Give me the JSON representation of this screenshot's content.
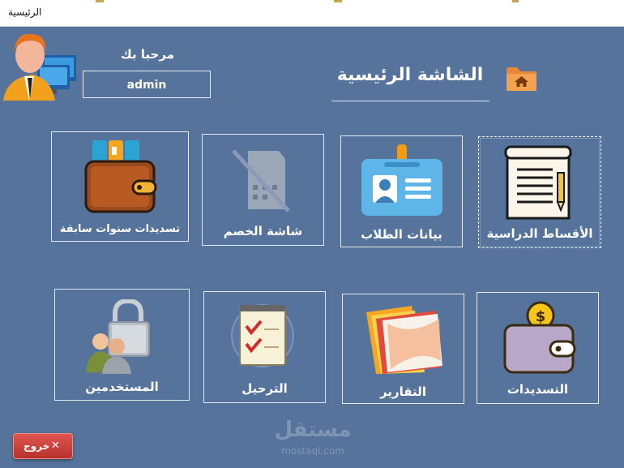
{
  "window": {
    "title": "الرئيسية"
  },
  "header": {
    "welcome": "مرحبا بك",
    "username": "admin",
    "page_title": "الشاشة الرئيسية"
  },
  "tiles_row1": [
    {
      "label": "الأقساط الدراسية",
      "icon": "notepad-icon"
    },
    {
      "label": "بيانات الطلاب",
      "icon": "id-badge-icon"
    },
    {
      "label": "شاشة الخصم",
      "icon": "discount-crossed-icon"
    },
    {
      "label": "تسديدات سنوات سابقة",
      "icon": "wallet-cards-icon"
    }
  ],
  "tiles_row2": [
    {
      "label": "التسديدات",
      "icon": "wallet-coin-icon"
    },
    {
      "label": "التقارير",
      "icon": "folder-reports-icon"
    },
    {
      "label": "الترحيل",
      "icon": "checklist-icon"
    },
    {
      "label": "المستخدمين",
      "icon": "users-lock-icon"
    }
  ],
  "exit": {
    "label": "خروج",
    "icon": "close-icon"
  },
  "watermark": {
    "arabic": "مستقل",
    "latin": "mostaql.com"
  },
  "colors": {
    "background": "#55739b",
    "tile_border": "#e3e9f1",
    "exit_button": "#c9403a",
    "folder": "#f0a050"
  }
}
